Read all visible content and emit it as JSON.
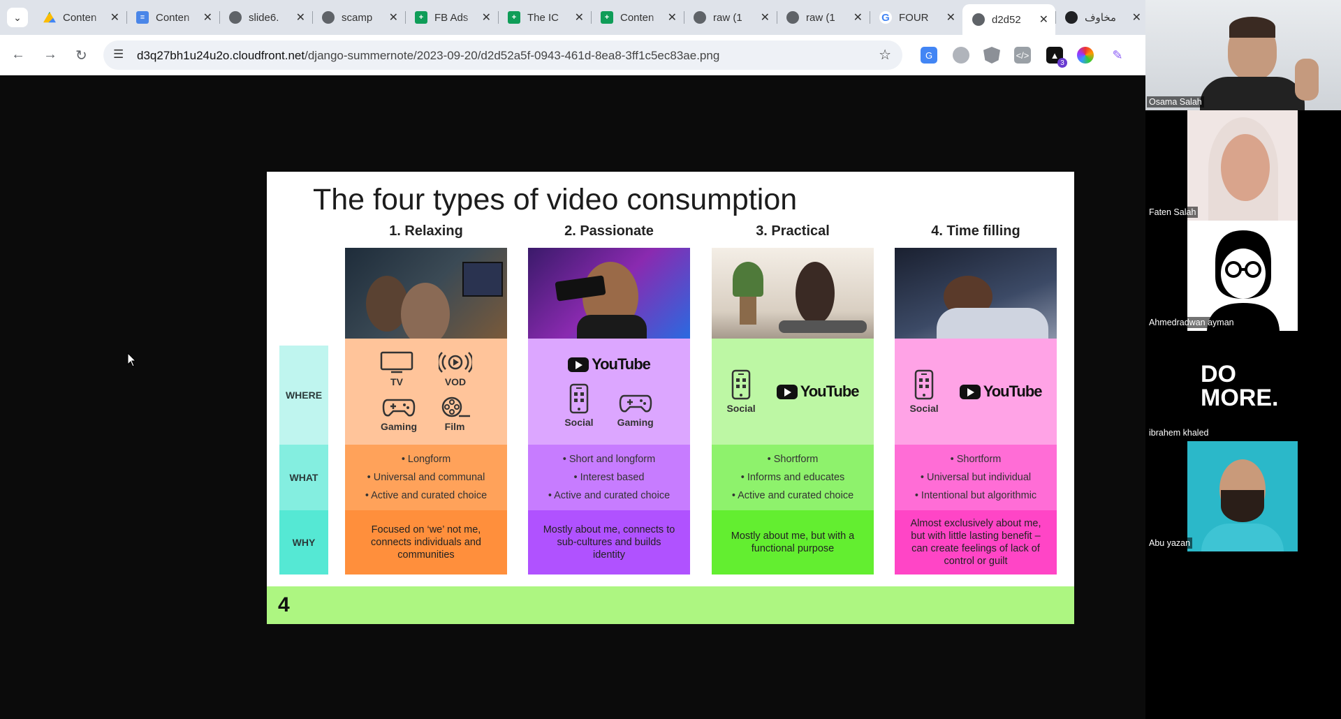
{
  "browser": {
    "tabs": [
      {
        "title": "Conten",
        "favicon": "drive-icon"
      },
      {
        "title": "Conten",
        "favicon": "docs-icon"
      },
      {
        "title": "slide6.",
        "favicon": "globe-icon"
      },
      {
        "title": "scamp",
        "favicon": "globe-icon"
      },
      {
        "title": "FB Ads",
        "favicon": "sheets-icon"
      },
      {
        "title": "The IC",
        "favicon": "sheets-icon"
      },
      {
        "title": "Conten",
        "favicon": "sheets-icon"
      },
      {
        "title": "raw (1",
        "favicon": "globe-icon"
      },
      {
        "title": "raw (1",
        "favicon": "globe-icon"
      },
      {
        "title": "FOUR",
        "favicon": "google-icon"
      },
      {
        "title": "d2d52",
        "favicon": "globe-icon",
        "active": true
      },
      {
        "title": "مخاوف",
        "favicon": "openai-icon"
      }
    ],
    "url_host": "d3q27bh1u24u2o.cloudfront.net",
    "url_path": "/django-summernote/2023-09-20/d2d52a5f-0943-461d-8ea8-3ff1c5ec83ae.png",
    "extension_badge": "3"
  },
  "slide": {
    "title": "The four types of video consumption",
    "rows": {
      "where": "WHERE",
      "what": "WHAT",
      "why": "WHY"
    },
    "columns": [
      {
        "heading": "1. Relaxing",
        "icons": [
          {
            "label": "TV",
            "icon": "tv-icon"
          },
          {
            "label": "VOD",
            "icon": "vod-icon"
          },
          {
            "label": "Gaming",
            "icon": "gamepad-icon"
          },
          {
            "label": "Film",
            "icon": "film-reel-icon"
          }
        ],
        "what": [
          "• Longform",
          "• Universal and communal",
          "• Active and curated choice"
        ],
        "why": "Focused on ‘we’ not me, connects individuals and communities"
      },
      {
        "heading": "2. Passionate",
        "youtube": "YouTube",
        "icons": [
          {
            "label": "Social",
            "icon": "phone-icon"
          },
          {
            "label": "Gaming",
            "icon": "gamepad-icon"
          }
        ],
        "what": [
          "• Short and longform",
          "• Interest based",
          "• Active and curated choice"
        ],
        "why": "Mostly about me, connects to sub-cultures and builds identity"
      },
      {
        "heading": "3. Practical",
        "youtube": "YouTube",
        "icons": [
          {
            "label": "Social",
            "icon": "phone-icon"
          }
        ],
        "what": [
          "• Shortform",
          "• Informs and educates",
          "• Active and curated choice"
        ],
        "why": "Mostly about me, but with a functional purpose"
      },
      {
        "heading": "4. Time filling",
        "youtube": "YouTube",
        "icons": [
          {
            "label": "Social",
            "icon": "phone-icon"
          }
        ],
        "what": [
          "• Shortform",
          "• Universal but individual",
          "• Intentional but algorithmic"
        ],
        "why": "Almost exclusively about me, but with little lasting benefit – can create feelings of lack of control or guilt"
      }
    ],
    "colors": {
      "relaxing": [
        "#ffc49a",
        "#ffa25a",
        "#ff8f3c"
      ],
      "passionate": [
        "#dca6ff",
        "#c77cff",
        "#b052ff"
      ],
      "practical": [
        "#bdf7a4",
        "#8ef26c",
        "#63ee30"
      ],
      "time_filling": [
        "#ffa3e6",
        "#ff6dd6",
        "#ff45c6"
      ],
      "labels": [
        "#bff5ef",
        "#84eee0",
        "#55e8d4"
      ],
      "footer": "#adf681"
    },
    "footer_logo": "4"
  },
  "call": {
    "participants": [
      {
        "name": "Osama Salah"
      },
      {
        "name": "Faten Salah"
      },
      {
        "name": "Ahmedradwan ayman"
      },
      {
        "name": "ibrahem khaled",
        "avatar_text": "DO MORE."
      },
      {
        "name": "Abu yazan"
      }
    ]
  }
}
